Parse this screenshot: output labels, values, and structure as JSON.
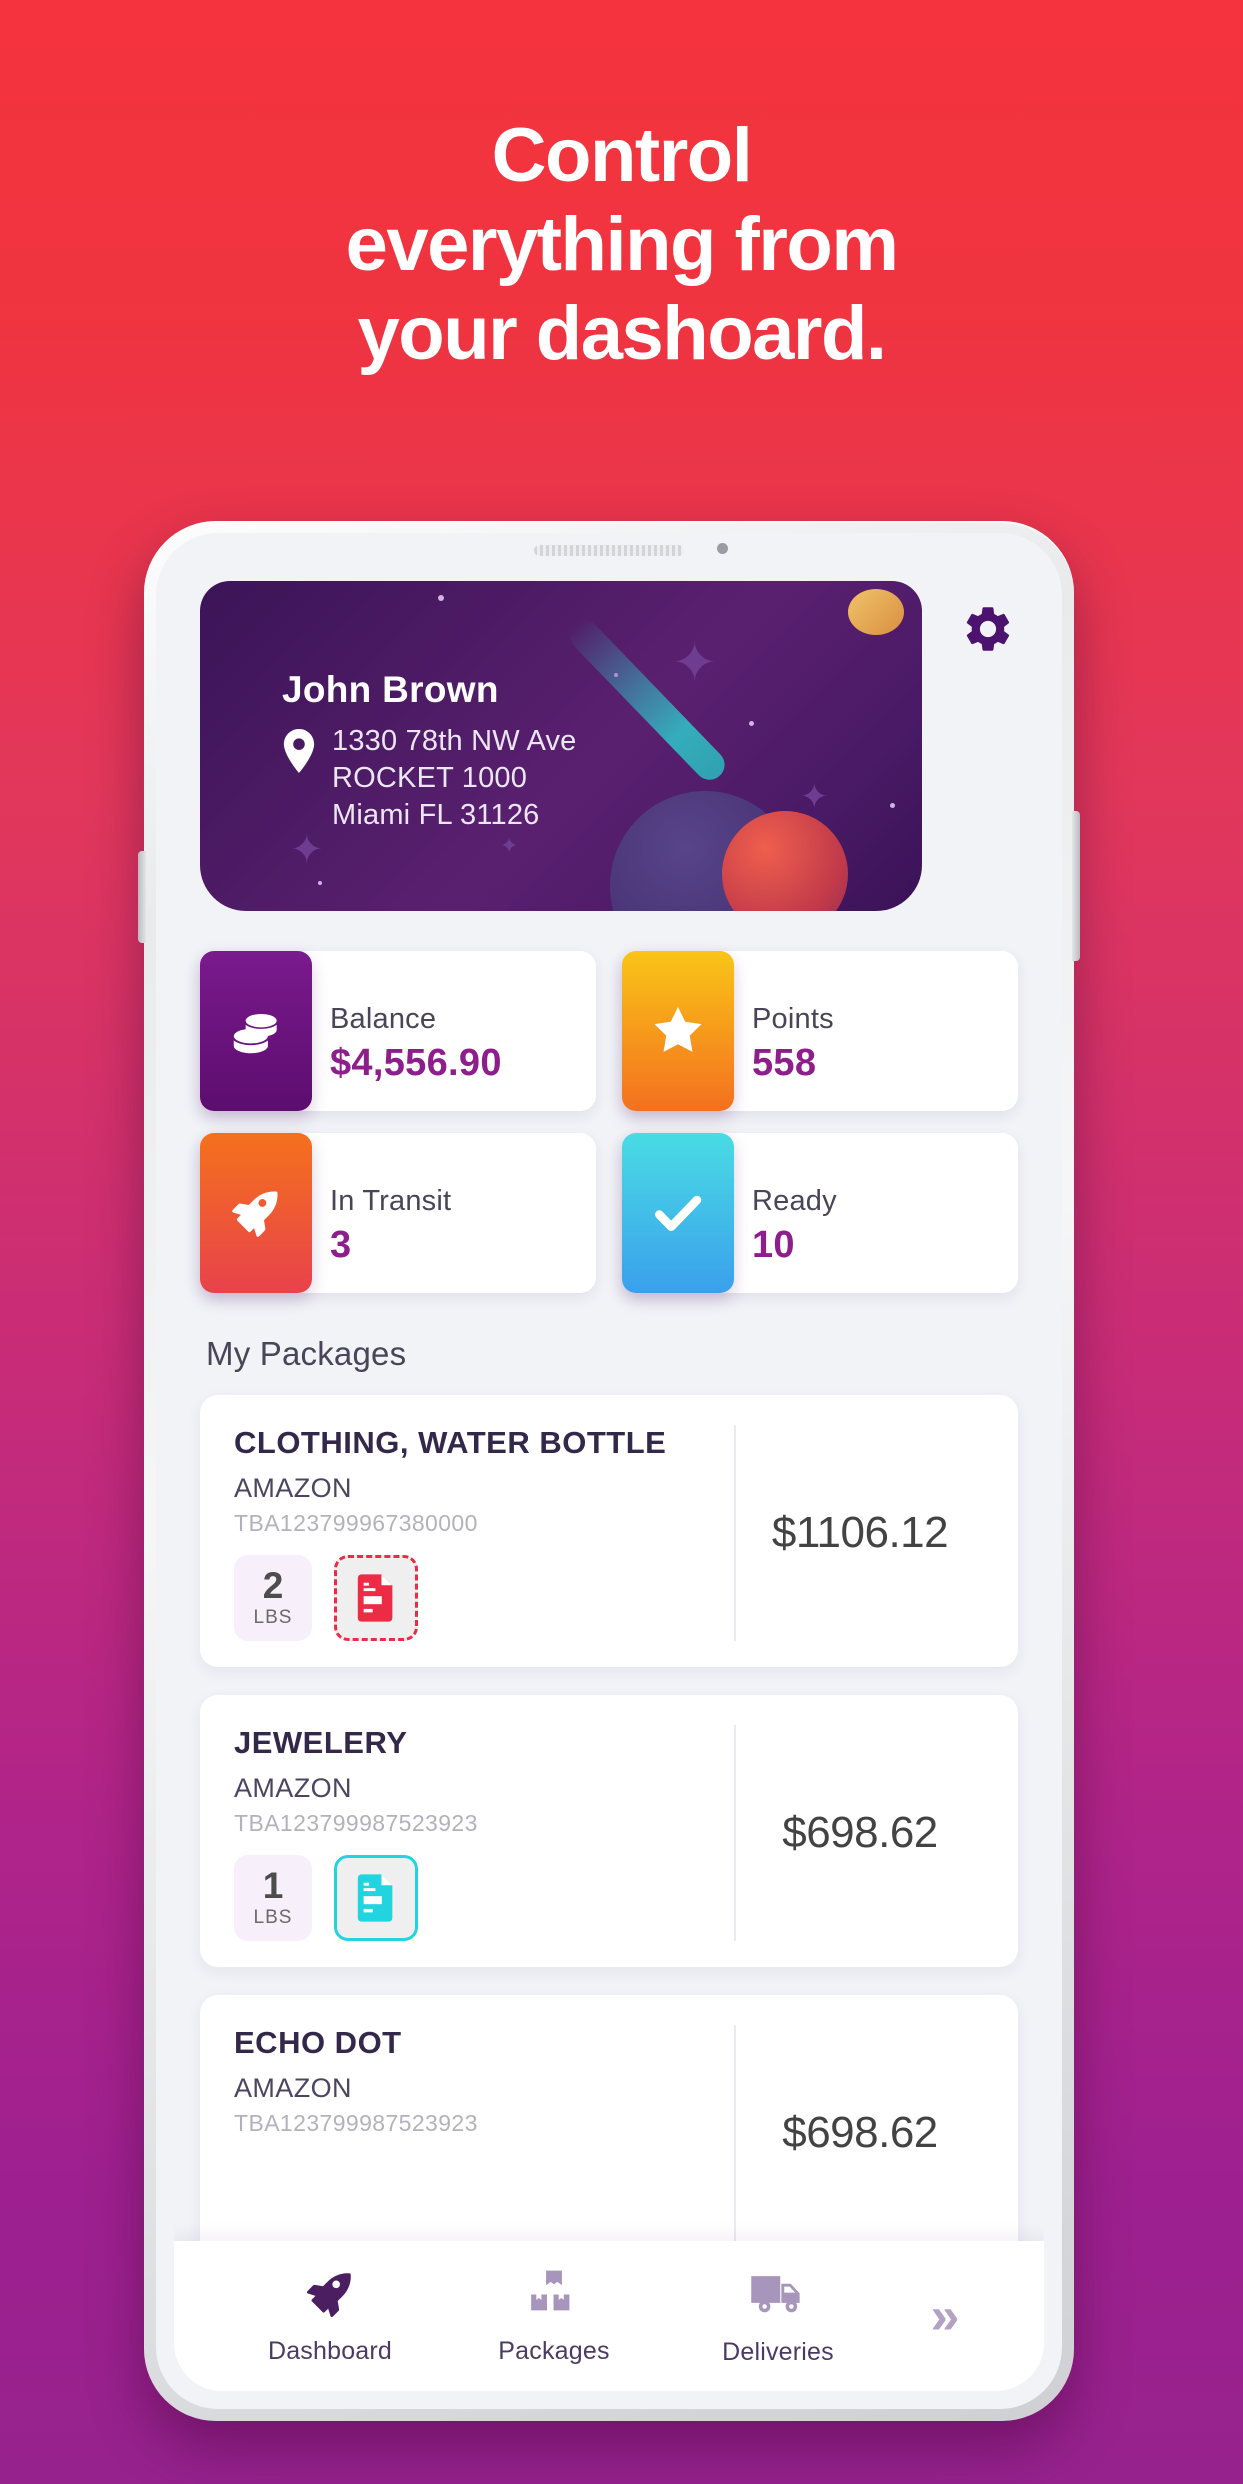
{
  "headline": {
    "line1": "Control",
    "line2": "everything from",
    "line3": "your dashoard."
  },
  "colors": {
    "bg_top": "#F4333E",
    "bg_bottom": "#96228E",
    "accent_purple": "#8D1E8C",
    "invoice_red": "#ED2B45",
    "invoice_cyan": "#21D5E0"
  },
  "address_card": {
    "name": "John Brown",
    "line1": "1330 78th NW Ave",
    "line2": "ROCKET 1000",
    "line3": "Miami FL 31126",
    "pin_icon": "location-pin-icon"
  },
  "settings_button": {
    "icon": "gear-icon"
  },
  "stats": [
    {
      "label": "Balance",
      "value": "$4,556.90",
      "icon": "coins-icon",
      "icon_color_start": "#7A1A8E",
      "icon_color_end": "#5C0D6E"
    },
    {
      "label": "Points",
      "value": "558",
      "icon": "star-icon",
      "icon_color_start": "#F9C517",
      "icon_color_end": "#F4701F"
    },
    {
      "label": "In Transit",
      "value": "3",
      "icon": "rocket-icon",
      "icon_color_start": "#F4711C",
      "icon_color_end": "#E8424C"
    },
    {
      "label": "Ready",
      "value": "10",
      "icon": "check-icon",
      "icon_color_start": "#49DCE4",
      "icon_color_end": "#3AA0EC"
    }
  ],
  "packages_section": {
    "title": "My Packages"
  },
  "packages": [
    {
      "name": "CLOTHING, WATER BOTTLE",
      "merchant": "AMAZON",
      "tracking": "TBA123799967380000",
      "weight": "2",
      "weight_unit": "LBS",
      "invoice_icon": "invoice-document-icon",
      "invoice_style": "red",
      "price": "$1106.12"
    },
    {
      "name": "JEWELERY",
      "merchant": "AMAZON",
      "tracking": "TBA123799987523923",
      "weight": "1",
      "weight_unit": "LBS",
      "invoice_icon": "invoice-document-icon",
      "invoice_style": "cyan",
      "price": "$698.62"
    },
    {
      "name": "ECHO DOT",
      "merchant": "AMAZON",
      "tracking": "TBA123799987523923",
      "weight": "",
      "weight_unit": "",
      "invoice_icon": "",
      "invoice_style": "",
      "price": "$698.62"
    }
  ],
  "bottom_nav": {
    "items": [
      {
        "label": "Dashboard",
        "icon": "rocket-icon",
        "active": true
      },
      {
        "label": "Packages",
        "icon": "boxes-icon",
        "active": false
      },
      {
        "label": "Deliveries",
        "icon": "truck-icon",
        "active": false
      }
    ],
    "more_label": "»"
  }
}
